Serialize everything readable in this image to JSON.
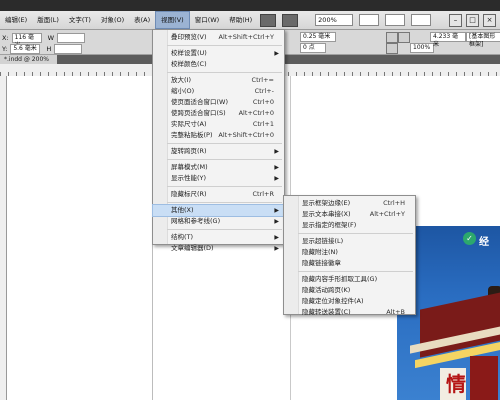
{
  "menubar": {
    "items": [
      {
        "label": "编辑(E)"
      },
      {
        "label": "版面(L)"
      },
      {
        "label": "文字(T)"
      },
      {
        "label": "对象(O)"
      },
      {
        "label": "表(A)"
      },
      {
        "label": "视图(V)"
      },
      {
        "label": "窗口(W)"
      },
      {
        "label": "帮助(H)"
      }
    ],
    "zoom": "200%"
  },
  "control_bar": {
    "x_value": "116 毫米",
    "y_value": "5.6 毫米",
    "w_label": "W",
    "h_label": "H",
    "stroke_weight": "0.25 毫米",
    "pt_value": "0 点",
    "percent": "100%",
    "width_mm": "4.233 毫米",
    "frame_label": "[基本图形框架]"
  },
  "document_tab": "*.indd @ 200%",
  "view_menu": {
    "items": [
      {
        "label": "叠印预览(V)",
        "shortcut": "Alt+Shift+Ctrl+Y",
        "submenu": false
      },
      {
        "separator": true
      },
      {
        "label": "校样设置(U)",
        "shortcut": "",
        "submenu": true
      },
      {
        "label": "校样颜色(C)",
        "shortcut": "",
        "submenu": false
      },
      {
        "separator": true
      },
      {
        "label": "放大(I)",
        "shortcut": "Ctrl+=",
        "submenu": false
      },
      {
        "label": "缩小(O)",
        "shortcut": "Ctrl+-",
        "submenu": false
      },
      {
        "label": "使页面适合窗口(W)",
        "shortcut": "Ctrl+0",
        "submenu": false
      },
      {
        "label": "使跨页适合窗口(S)",
        "shortcut": "Alt+Ctrl+0",
        "submenu": false
      },
      {
        "label": "实际尺寸(A)",
        "shortcut": "Ctrl+1",
        "submenu": false
      },
      {
        "label": "完整粘贴板(P)",
        "shortcut": "Alt+Shift+Ctrl+0",
        "submenu": false
      },
      {
        "separator": true
      },
      {
        "label": "旋转跨页(R)",
        "shortcut": "",
        "submenu": true
      },
      {
        "separator": true
      },
      {
        "label": "屏幕模式(M)",
        "shortcut": "",
        "submenu": true
      },
      {
        "label": "显示性能(Y)",
        "shortcut": "",
        "submenu": true
      },
      {
        "separator": true
      },
      {
        "label": "隐藏标尺(R)",
        "shortcut": "Ctrl+R",
        "submenu": false
      },
      {
        "separator": true
      },
      {
        "label": "其他(X)",
        "shortcut": "",
        "submenu": true,
        "highlighted": true
      },
      {
        "label": "网格和参考线(G)",
        "shortcut": "",
        "submenu": true
      },
      {
        "separator": true
      },
      {
        "label": "结构(T)",
        "shortcut": "",
        "submenu": true
      },
      {
        "label": "文章编辑器(D)",
        "shortcut": "",
        "submenu": true
      }
    ]
  },
  "other_submenu": {
    "items": [
      {
        "label": "显示框架边缘(E)",
        "shortcut": "Ctrl+H"
      },
      {
        "label": "显示文本串接(X)",
        "shortcut": "Alt+Ctrl+Y"
      },
      {
        "label": "显示指定的框架(F)",
        "shortcut": ""
      },
      {
        "separator": true
      },
      {
        "label": "显示超链接(L)",
        "shortcut": ""
      },
      {
        "label": "隐藏附注(N)",
        "shortcut": ""
      },
      {
        "label": "隐藏链接徽章",
        "shortcut": ""
      },
      {
        "separator": true
      },
      {
        "label": "隐藏内容手形抓取工具(G)",
        "shortcut": ""
      },
      {
        "label": "隐藏活动跨页(K)",
        "shortcut": ""
      },
      {
        "label": "隐藏定位对象控件(A)",
        "shortcut": ""
      },
      {
        "label": "隐藏转送装置(C)",
        "shortcut": "Alt+B"
      }
    ]
  },
  "canvas_image": {
    "logo_text": "经",
    "sign_text": "情"
  },
  "colors": {
    "menu_highlight": "#c9def5",
    "title_bar": "#2b2b2b",
    "image_blue": "#2a6dc1",
    "roof_red": "#7a1b19"
  }
}
